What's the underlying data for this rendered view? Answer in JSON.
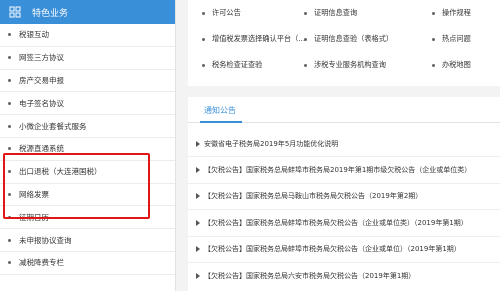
{
  "sidebar": {
    "header_title": "特色业务",
    "items": [
      {
        "label": "税银互动"
      },
      {
        "label": "网签三方协议"
      },
      {
        "label": "房产交易申报"
      },
      {
        "label": "电子签名协议"
      },
      {
        "label": "小微企业套餐式服务"
      },
      {
        "label": "税源直通系统"
      },
      {
        "label": "出口退税（大连港国税）"
      },
      {
        "label": "网络发票"
      },
      {
        "label": "征期日历"
      },
      {
        "label": "未申报协议查询"
      },
      {
        "label": "减税降费专栏"
      }
    ]
  },
  "links": [
    {
      "label": "许可公告"
    },
    {
      "label": "证明信息查询"
    },
    {
      "label": "操作规程"
    },
    {
      "label": "增值税发票选择确认平台（..."
    },
    {
      "label": "证明信息查验（表格式）"
    },
    {
      "label": "热点问题"
    },
    {
      "label": "税务检查证查验"
    },
    {
      "label": "涉税专业服务机构查询"
    },
    {
      "label": "办税地图"
    }
  ],
  "notices": {
    "tab_label": "通知公告",
    "items": [
      {
        "text": "安徽省电子税务局2019年5月功能优化说明"
      },
      {
        "text": "【欠税公告】国家税务总局蚌埠市税务局2019年第1期市级欠税公告（企业或单位类）"
      },
      {
        "text": "【欠税公告】国家税务总局马鞍山市税务局欠税公告（2019年第2期）"
      },
      {
        "text": "【欠税公告】国家税务总局蚌埠市税务局欠税公告（企业或单位类）（2019年第1期）"
      },
      {
        "text": "【欠税公告】国家税务总局蚌埠市税务局欠税公告（企业或单位）（2019年第1期）"
      },
      {
        "text": "【欠税公告】国家税务总局六安市税务局欠税公告（2019年第1期）"
      }
    ]
  },
  "colors": {
    "accent": "#3a8fd9",
    "highlight": "#e01515"
  }
}
